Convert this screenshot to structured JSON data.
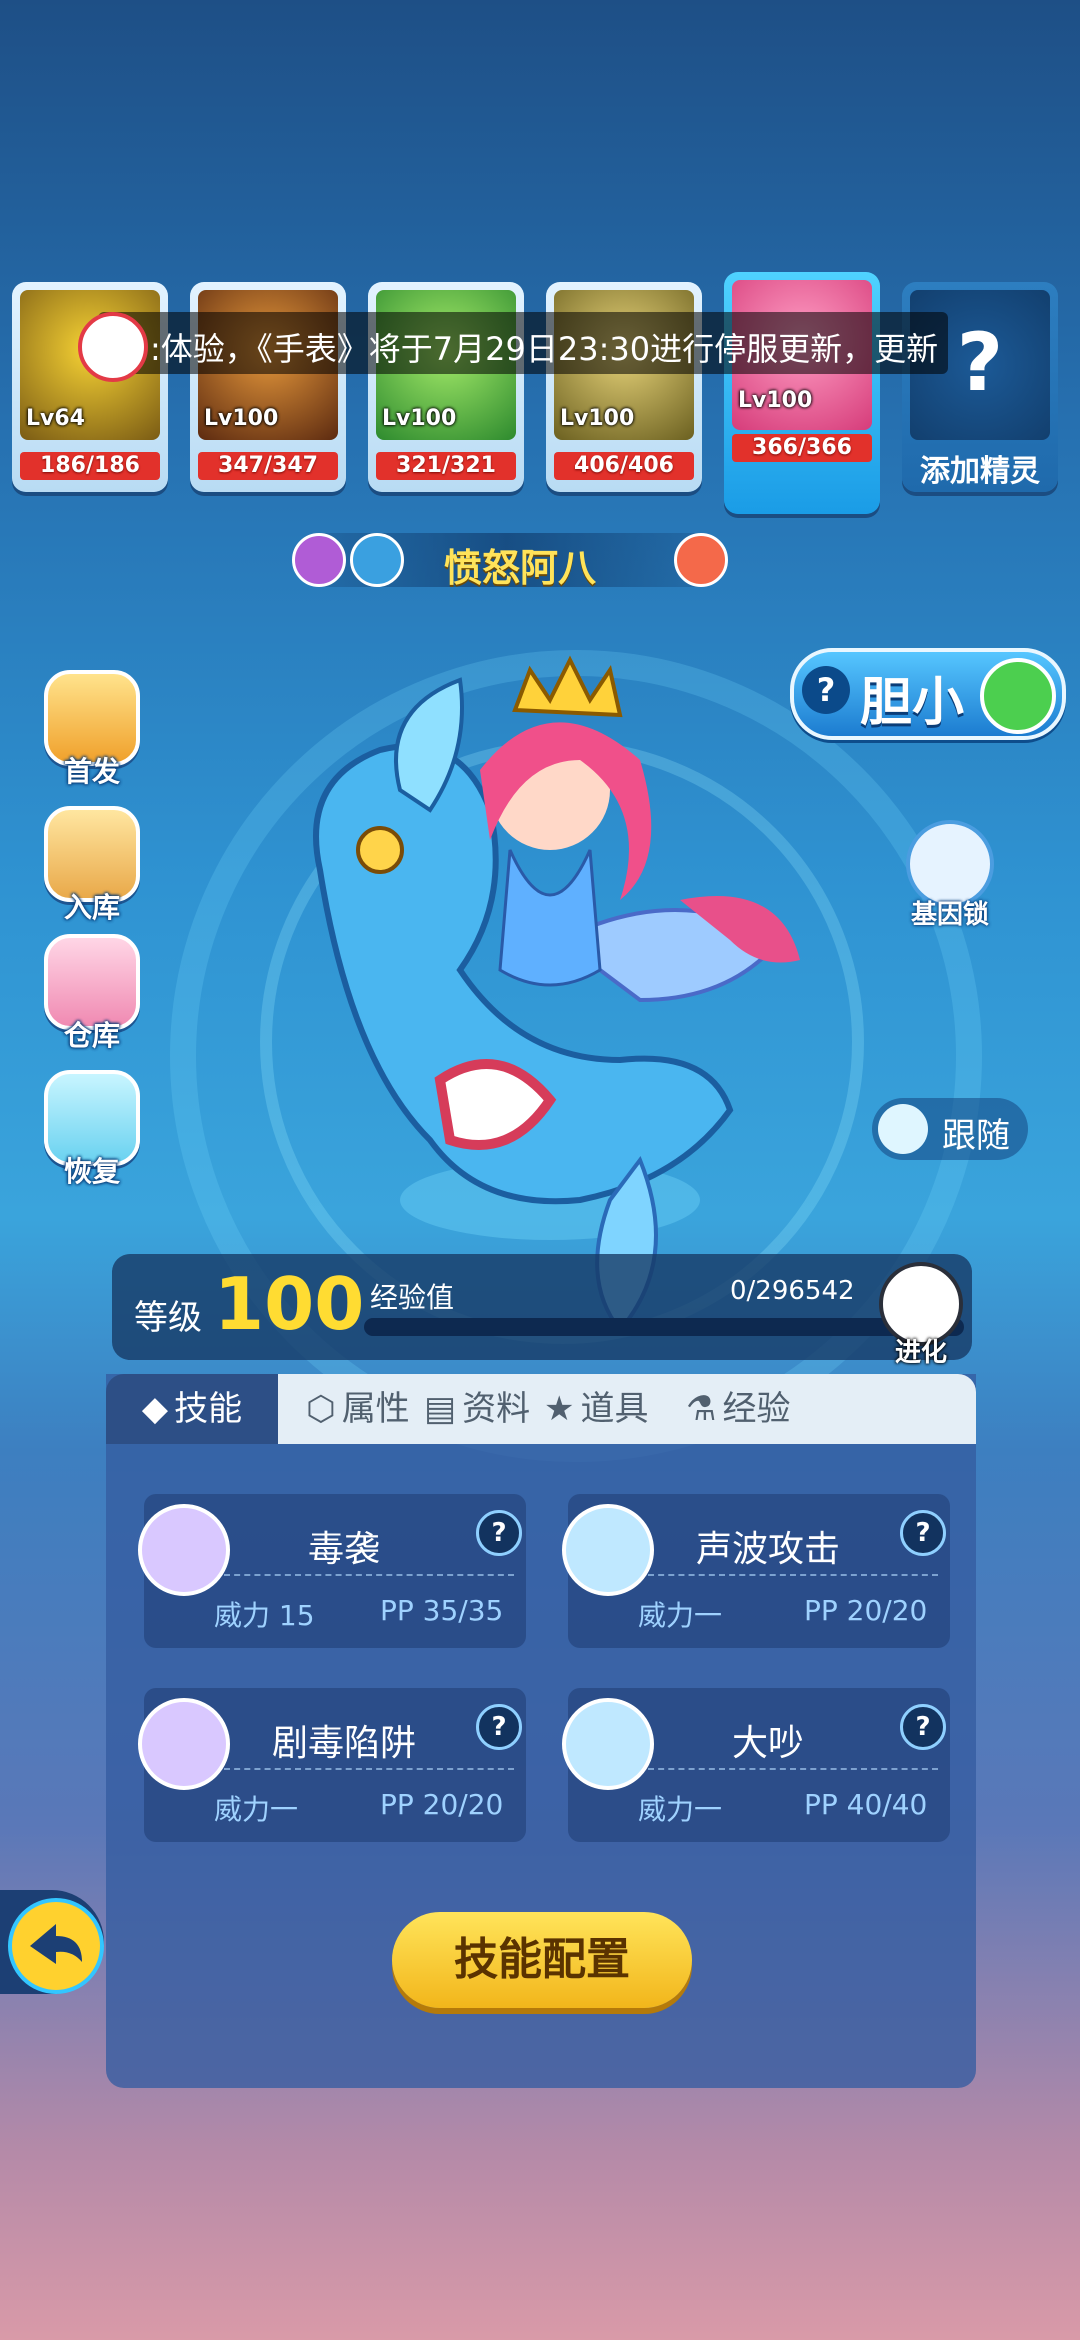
{
  "slots": [
    {
      "level": "Lv64",
      "hp": "186/186"
    },
    {
      "level": "Lv100",
      "hp": "347/347"
    },
    {
      "level": "Lv100",
      "hp": "321/321"
    },
    {
      "level": "Lv100",
      "hp": "406/406"
    },
    {
      "level": "Lv100",
      "hp": "366/366"
    }
  ],
  "add_slot_label": "添加精灵",
  "marquee_text": ":体验，《手表》将于7月29日23:30进行停服更新，更新",
  "pet_name": "愤怒阿八",
  "personality": "胆小",
  "side_buttons": [
    "首发",
    "入库",
    "仓库",
    "恢复"
  ],
  "gene_lock": "基因锁",
  "follow_label": "跟随",
  "level_label": "等级",
  "level_value": "100",
  "exp_label": "经验值",
  "exp_value": "0/296542",
  "exp_progress": 0,
  "evolve_label": "进化",
  "tabs": [
    "技能",
    "属性",
    "资料",
    "道具",
    "经验"
  ],
  "skills": [
    {
      "name": "毒袭",
      "power": "威力 15",
      "pp": "PP 35/35",
      "icon": "skull-icon"
    },
    {
      "name": "声波攻击",
      "power": "威力一",
      "pp": "PP 20/20",
      "icon": "sonic-icon"
    },
    {
      "name": "剧毒陷阱",
      "power": "威力一",
      "pp": "PP 20/20",
      "icon": "skull-icon"
    },
    {
      "name": "大吵",
      "power": "威力一",
      "pp": "PP 40/40",
      "icon": "sonic-icon"
    }
  ],
  "skill_config_label": "技能配置",
  "help_glyph": "?",
  "colors": {
    "accent": "#ffdc32",
    "hp": "#e2312b",
    "button": "#f2b61b"
  }
}
